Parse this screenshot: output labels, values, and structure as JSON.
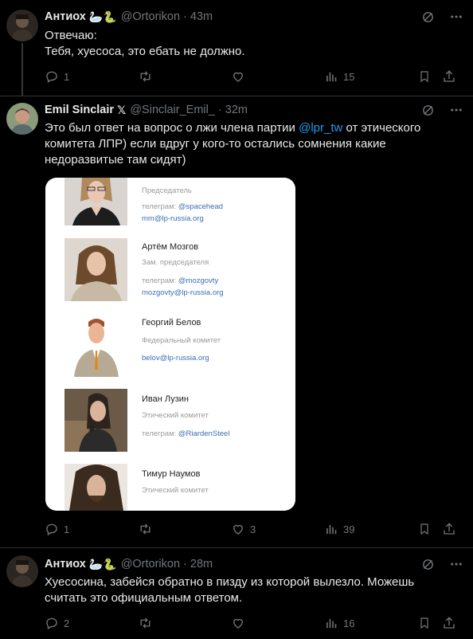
{
  "tweets": [
    {
      "name": "Антиох",
      "emojis": "🦢🐍",
      "handle": "@Ortorikon",
      "dot": "·",
      "time": "43m",
      "text_lines": [
        "Отвечаю:",
        "Тебя, хуесоса, это ебать не должно."
      ],
      "replies": "1",
      "retweets": "",
      "likes": "",
      "views": "15"
    },
    {
      "name": "Emil Sinclair",
      "badge": "𝕏",
      "handle": "@Sinclair_Emil_",
      "dot": "·",
      "time": "32m",
      "text_pre": "Это был ответ на вопрос о лжи члена партии ",
      "mention": "@lpr_tw",
      "text_post": " от этического комитета ЛПР) если вдруг у кого-то остались сомнения какие недоразвитые там сидят)",
      "replies": "1",
      "retweets": "",
      "likes": "3",
      "views": "39"
    },
    {
      "name": "Антиох",
      "emojis": "🦢🐍",
      "handle": "@Ortorikon",
      "dot": "·",
      "time": "28m",
      "text": "Хуесосина, забейся обратно в пизду из которой вылезло. Можешь считать это официальным ответом.",
      "replies": "2",
      "retweets": "",
      "likes": "",
      "views": "16"
    }
  ],
  "card": {
    "members": [
      {
        "name": "",
        "role": "Председатель",
        "tg_label": "телеграм: ",
        "tg": "@spacehead",
        "email": "mm@lp-russia.org"
      },
      {
        "name": "Артём Мозгов",
        "role": "Зам. председателя",
        "tg_label": "телеграм: ",
        "tg": "@mozgovty",
        "email": "mozgovty@lp-russia.org"
      },
      {
        "name": "Георгий Белов",
        "role": "Федеральный комитет",
        "tg_label": "",
        "tg": "",
        "email": "belov@lp-russia.org"
      },
      {
        "name": "Иван Лузин",
        "role": "Этический комитет",
        "tg_label": "телеграм: ",
        "tg": "@RiardenSteel",
        "email": ""
      },
      {
        "name": "Тимур Наумов",
        "role": "Этический комитет",
        "tg_label": "",
        "tg": "",
        "email": ""
      }
    ]
  },
  "icons": {
    "grok": "grok-icon",
    "more": "more-icon",
    "reply": "reply-icon",
    "retweet": "retweet-icon",
    "like": "like-icon",
    "views": "views-icon",
    "bookmark": "bookmark-icon",
    "share": "share-icon"
  }
}
